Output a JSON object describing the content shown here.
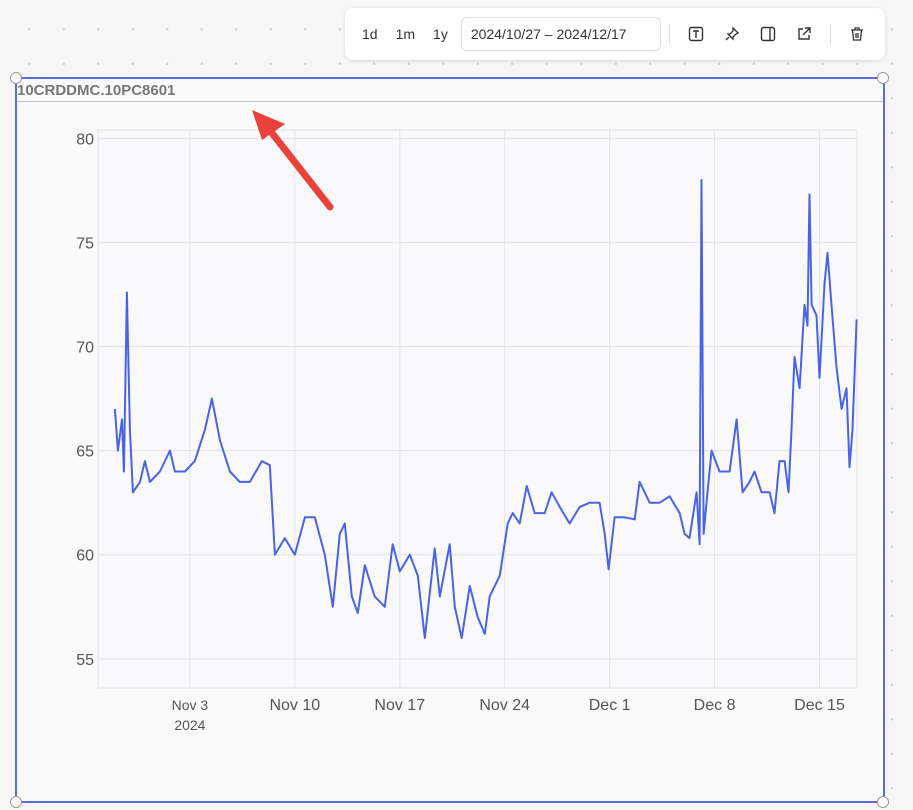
{
  "toolbar": {
    "range_buttons": [
      "1d",
      "1m",
      "1y"
    ],
    "date_range": "2024/10/27 – 2024/12/17",
    "icons": [
      "text-icon",
      "pin-icon",
      "split-panel-icon",
      "external-link-icon",
      "trash-icon"
    ]
  },
  "widget": {
    "title": "10CRDDMC.10PC8601"
  },
  "colors": {
    "line": "#4a63e6",
    "frame": "#5b6ee0",
    "arrow": "#e8423a"
  },
  "chart_data": {
    "type": "line",
    "title": "10CRDDMC.10PC8601",
    "xlabel": "",
    "ylabel": "",
    "x_unit": "days since 2024-10-27",
    "xlim": [
      0.87,
      51.5
    ],
    "ylim": [
      53.6,
      80.4
    ],
    "yticks": [
      55,
      60,
      65,
      70,
      75,
      80
    ],
    "xticks": [
      {
        "x": 7,
        "label": "Nov 3",
        "sub": "2024"
      },
      {
        "x": 14,
        "label": "Nov 10"
      },
      {
        "x": 21,
        "label": "Nov 17"
      },
      {
        "x": 28,
        "label": "Nov 24"
      },
      {
        "x": 35,
        "label": "Dec 1"
      },
      {
        "x": 42,
        "label": "Dec 8"
      },
      {
        "x": 49,
        "label": "Dec 15"
      }
    ],
    "grid": true,
    "series": [
      {
        "name": "10CRDDMC.10PC8601",
        "x": [
          2.0,
          2.2,
          2.47,
          2.6,
          2.8,
          3.0,
          3.2,
          3.67,
          4.0,
          4.33,
          5.0,
          5.67,
          6.0,
          6.67,
          7.33,
          8.0,
          8.47,
          9.0,
          9.67,
          10.33,
          11.0,
          11.8,
          12.33,
          12.67,
          13.33,
          14.0,
          14.67,
          15.33,
          16.0,
          16.53,
          17.0,
          17.33,
          17.8,
          18.2,
          18.67,
          19.33,
          20.0,
          20.53,
          21.0,
          21.67,
          22.2,
          22.67,
          23.33,
          23.67,
          24.33,
          24.67,
          25.13,
          25.67,
          26.2,
          26.67,
          27.0,
          27.67,
          28.2,
          28.53,
          29.0,
          29.47,
          30.0,
          30.67,
          31.13,
          31.67,
          32.33,
          33.0,
          33.67,
          34.33,
          34.67,
          34.93,
          35.33,
          36.0,
          36.67,
          37.0,
          37.67,
          38.33,
          39.0,
          39.67,
          40.0,
          40.33,
          40.8,
          41.0,
          41.13,
          41.27,
          41.53,
          41.8,
          42.33,
          43.0,
          43.47,
          43.87,
          44.33,
          44.67,
          45.13,
          45.67,
          46.0,
          46.33,
          46.67,
          46.93,
          47.13,
          47.33,
          47.67,
          48.0,
          48.2,
          48.33,
          48.47,
          48.8,
          49.0,
          49.33,
          49.53,
          49.8,
          50.13,
          50.47,
          50.8,
          51.0,
          51.2,
          51.47
        ],
        "y": [
          67,
          65,
          66.5,
          64,
          72.6,
          66,
          63,
          63.5,
          64.5,
          63.5,
          64,
          65,
          64,
          64,
          64.5,
          66,
          67.5,
          65.5,
          64,
          63.5,
          63.5,
          64.5,
          64.3,
          60,
          60.8,
          60,
          61.8,
          61.8,
          60,
          57.5,
          61,
          61.5,
          58,
          57.2,
          59.5,
          58,
          57.5,
          60.5,
          59.2,
          60,
          59,
          56,
          60.3,
          58,
          60.5,
          57.5,
          56,
          58.5,
          57,
          56.2,
          58,
          59,
          61.5,
          62,
          61.5,
          63.3,
          62,
          62,
          63,
          62.3,
          61.5,
          62.3,
          62.5,
          62.5,
          61,
          59.3,
          61.8,
          61.8,
          61.7,
          63.5,
          62.5,
          62.5,
          62.8,
          62,
          61,
          60.8,
          63,
          60.5,
          78,
          61,
          63,
          65,
          64,
          64,
          66.5,
          63,
          63.5,
          64,
          63,
          63,
          62,
          64.5,
          64.5,
          63,
          66,
          69.5,
          68,
          72,
          71,
          77.3,
          72,
          71.5,
          68.5,
          73,
          74.5,
          72,
          69,
          67,
          68,
          64.2,
          66,
          71.3
        ]
      }
    ]
  }
}
